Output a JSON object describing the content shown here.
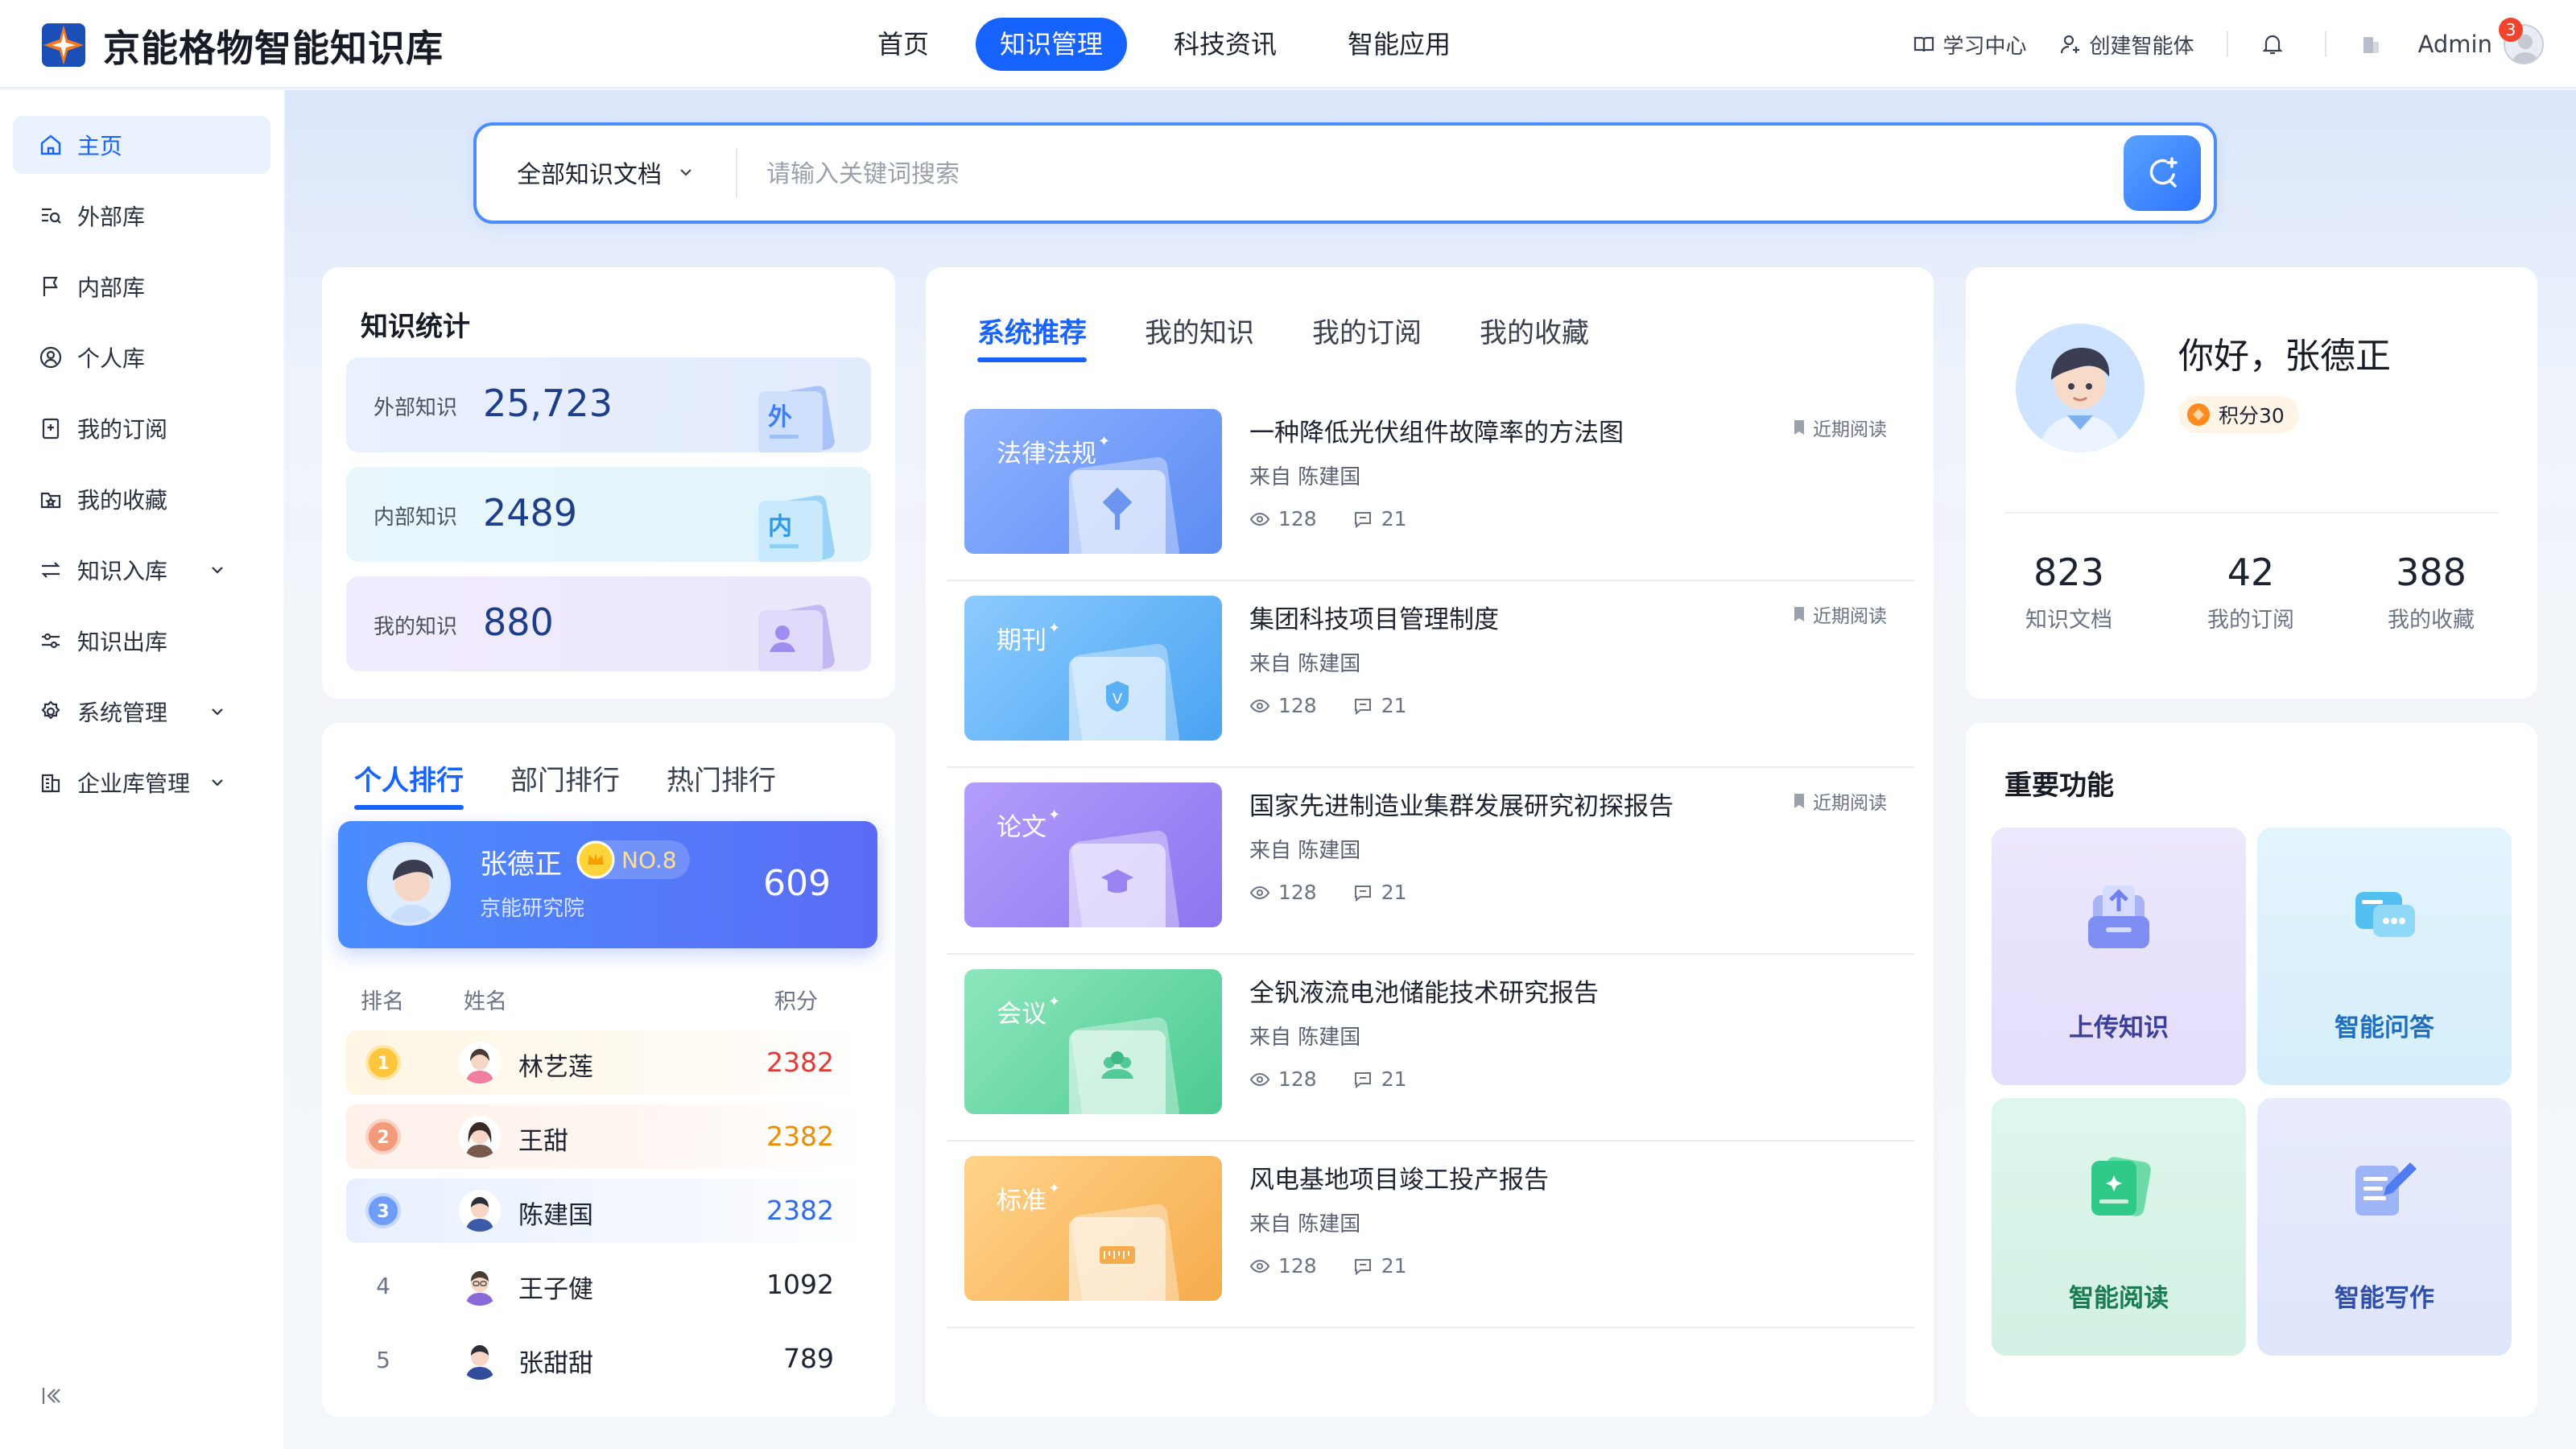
{
  "app": {
    "title": "京能格物智能知识库"
  },
  "nav": [
    {
      "label": "首页"
    },
    {
      "label": "知识管理",
      "active": true
    },
    {
      "label": "科技资讯"
    },
    {
      "label": "智能应用"
    }
  ],
  "header_tools": {
    "learning": "学习中心",
    "create_agent": "创建智能体",
    "user": "Admin",
    "notification_count": "3"
  },
  "sidebar": {
    "items": [
      {
        "label": "主页",
        "icon": "home-icon",
        "active": true
      },
      {
        "label": "外部库",
        "icon": "list-search-icon"
      },
      {
        "label": "内部库",
        "icon": "flag-icon"
      },
      {
        "label": "个人库",
        "icon": "user-circle-icon"
      },
      {
        "label": "我的订阅",
        "icon": "bookmark-add-icon"
      },
      {
        "label": "我的收藏",
        "icon": "folder-star-icon"
      },
      {
        "label": "知识入库",
        "icon": "arrows-swap-icon",
        "expandable": true
      },
      {
        "label": "知识出库",
        "icon": "sliders-icon"
      },
      {
        "label": "系统管理",
        "icon": "gear-icon",
        "expandable": true
      },
      {
        "label": "企业库管理",
        "icon": "building-icon",
        "expandable": true
      }
    ]
  },
  "search": {
    "scope": "全部知识文档",
    "placeholder": "请输入关键词搜索"
  },
  "stats": {
    "title": "知识统计",
    "items": [
      {
        "label": "外部知识",
        "value": "25,723",
        "badge": "外"
      },
      {
        "label": "内部知识",
        "value": "2489",
        "badge": "内"
      },
      {
        "label": "我的知识",
        "value": "880"
      }
    ]
  },
  "ranking": {
    "tabs": [
      "个人排行",
      "部门排行",
      "热门排行"
    ],
    "top": {
      "name": "张德正",
      "rank": "NO.8",
      "dept": "京能研究院",
      "score": "609"
    },
    "headers": {
      "rank": "排名",
      "name": "姓名",
      "score": "积分"
    },
    "rows": [
      {
        "rank": "1",
        "name": "林艺莲",
        "score": "2382"
      },
      {
        "rank": "2",
        "name": "王甜",
        "score": "2382"
      },
      {
        "rank": "3",
        "name": "陈建国",
        "score": "2382"
      },
      {
        "rank": "4",
        "name": "王子健",
        "score": "1092"
      },
      {
        "rank": "5",
        "name": "张甜甜",
        "score": "789"
      }
    ]
  },
  "feed": {
    "tabs": [
      "系统推荐",
      "我的知识",
      "我的订阅",
      "我的收藏"
    ],
    "items": [
      {
        "category": "法律法规",
        "title": "一种降低光伏组件故障率的方法图",
        "source": "来自 陈建国",
        "views": "128",
        "comments": "21",
        "tag": "近期阅读"
      },
      {
        "category": "期刊",
        "title": "集团科技项目管理制度",
        "source": "来自 陈建国",
        "views": "128",
        "comments": "21",
        "tag": "近期阅读"
      },
      {
        "category": "论文",
        "title": "国家先进制造业集群发展研究初探报告",
        "source": "来自 陈建国",
        "views": "128",
        "comments": "21",
        "tag": "近期阅读"
      },
      {
        "category": "会议",
        "title": "全钒液流电池储能技术研究报告",
        "source": "来自 陈建国",
        "views": "128",
        "comments": "21",
        "tag": ""
      },
      {
        "category": "标准",
        "title": "风电基地项目竣工投产报告",
        "source": "来自 陈建国",
        "views": "128",
        "comments": "21",
        "tag": ""
      }
    ]
  },
  "profile": {
    "greeting": "你好，张德正",
    "points": "积分30",
    "stats": [
      {
        "value": "823",
        "label": "知识文档"
      },
      {
        "value": "42",
        "label": "我的订阅"
      },
      {
        "value": "388",
        "label": "我的收藏"
      }
    ]
  },
  "features": {
    "title": "重要功能",
    "items": [
      {
        "label": "上传知识"
      },
      {
        "label": "智能问答"
      },
      {
        "label": "智能阅读"
      },
      {
        "label": "智能写作"
      }
    ]
  }
}
